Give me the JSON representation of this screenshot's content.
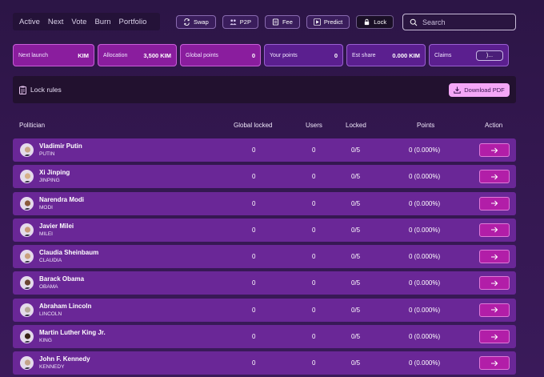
{
  "nav": {
    "tabs": [
      "Active",
      "Next",
      "Vote",
      "Burn",
      "Portfolio"
    ]
  },
  "actions": [
    {
      "label": "Swap",
      "icon": "swap-icon"
    },
    {
      "label": "P2P",
      "icon": "people-icon"
    },
    {
      "label": "Fee",
      "icon": "receipt-icon"
    },
    {
      "label": "Predict",
      "icon": "play-icon"
    },
    {
      "label": "Lock",
      "icon": "lock-icon"
    }
  ],
  "search": {
    "placeholder": "Search"
  },
  "stats": {
    "next_launch": {
      "label": "Next launch",
      "value": "KIM"
    },
    "allocation": {
      "label": "Allocation",
      "value": "3,500 KIM"
    },
    "global_points": {
      "label": "Global points",
      "value": "0"
    },
    "your_points": {
      "label": "Your points",
      "value": "0"
    },
    "est_share": {
      "label": "Est share",
      "value": "0.000 KIM"
    },
    "claims": {
      "label": "Claims",
      "button": ")..."
    }
  },
  "lock_rules": {
    "label": "Lock rules",
    "download": "Download PDF"
  },
  "table": {
    "headers": {
      "politician": "Politician",
      "global_locked": "Global locked",
      "users": "Users",
      "locked": "Locked",
      "points": "Points",
      "action": "Action"
    },
    "rows": [
      {
        "name": "Vladimir Putin",
        "ticker": "PUTIN",
        "global_locked": "0",
        "users": "0",
        "locked": "0/5",
        "points": "0 (0.000%)"
      },
      {
        "name": "Xi Jinping",
        "ticker": "JINPING",
        "global_locked": "0",
        "users": "0",
        "locked": "0/5",
        "points": "0 (0.000%)"
      },
      {
        "name": "Narendra Modi",
        "ticker": "MODI",
        "global_locked": "0",
        "users": "0",
        "locked": "0/5",
        "points": "0 (0.000%)"
      },
      {
        "name": "Javier Milei",
        "ticker": "MILEI",
        "global_locked": "0",
        "users": "0",
        "locked": "0/5",
        "points": "0 (0.000%)"
      },
      {
        "name": "Claudia Sheinbaum",
        "ticker": "CLAUDIA",
        "global_locked": "0",
        "users": "0",
        "locked": "0/5",
        "points": "0 (0.000%)"
      },
      {
        "name": "Barack Obama",
        "ticker": "OBAMA",
        "global_locked": "0",
        "users": "0",
        "locked": "0/5",
        "points": "0 (0.000%)"
      },
      {
        "name": "Abraham Lincoln",
        "ticker": "LINCOLN",
        "global_locked": "0",
        "users": "0",
        "locked": "0/5",
        "points": "0 (0.000%)"
      },
      {
        "name": "Martin Luther King Jr.",
        "ticker": "KING",
        "global_locked": "0",
        "users": "0",
        "locked": "0/5",
        "points": "0 (0.000%)"
      },
      {
        "name": "John F. Kennedy",
        "ticker": "KENNEDY",
        "global_locked": "0",
        "users": "0",
        "locked": "0/5",
        "points": "0 (0.000%)"
      }
    ]
  }
}
